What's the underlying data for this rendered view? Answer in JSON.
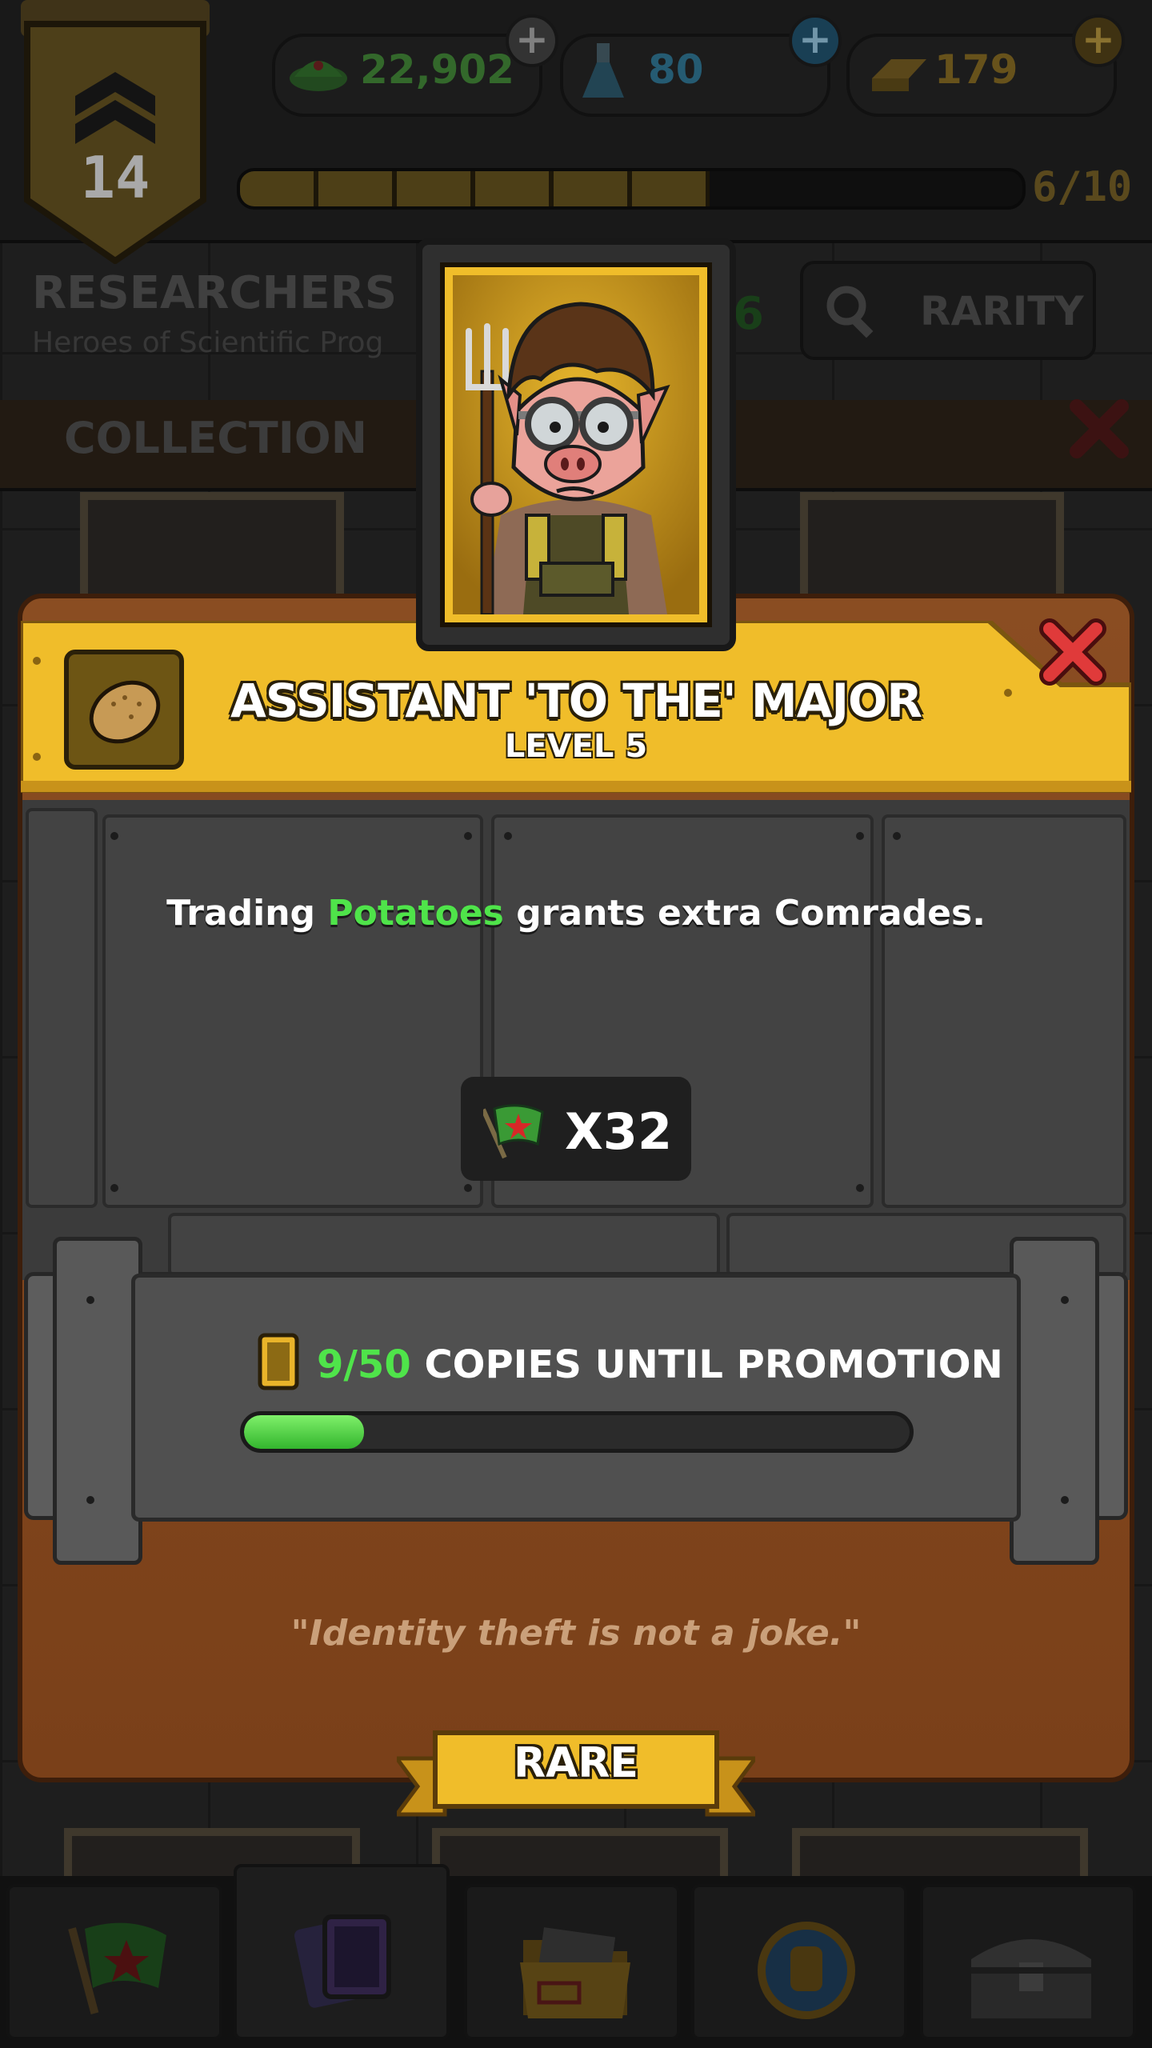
{
  "level": {
    "number": "14"
  },
  "resources": [
    {
      "name": "cash",
      "value": "22,902",
      "color": "#3f7f35",
      "icon": "cash-cap-icon"
    },
    {
      "name": "science",
      "value": "80",
      "color": "#2e6f8c",
      "icon": "flask-icon"
    },
    {
      "name": "gold",
      "value": "179",
      "color": "#7e6422",
      "icon": "gold-bars-icon"
    }
  ],
  "xp": {
    "label": "6/10",
    "progress": 0.6
  },
  "collection": {
    "title": "RESEARCHERS",
    "subtitle": "Heroes of Scientific Prog",
    "count_fragment": "6",
    "sort_label": "RARITY",
    "tab_label": "COLLECTION"
  },
  "popup": {
    "title": "ASSISTANT 'TO THE' MAJOR",
    "level": "LEVEL 5",
    "desc_prefix": "Trading",
    "desc_highlight": "Potatoes",
    "desc_suffix": "grants extra Comrades.",
    "reward_value": "X32",
    "copies_count": "9/50",
    "copies_label": "COPIES UNTIL PROMOTION",
    "copies_progress": 0.18,
    "quote": "\"Identity theft is not a joke.\"",
    "rarity": "RARE",
    "colors": {
      "accent": "#f0bd2a",
      "green": "#4fe44a",
      "red": "#e03a3a"
    }
  }
}
